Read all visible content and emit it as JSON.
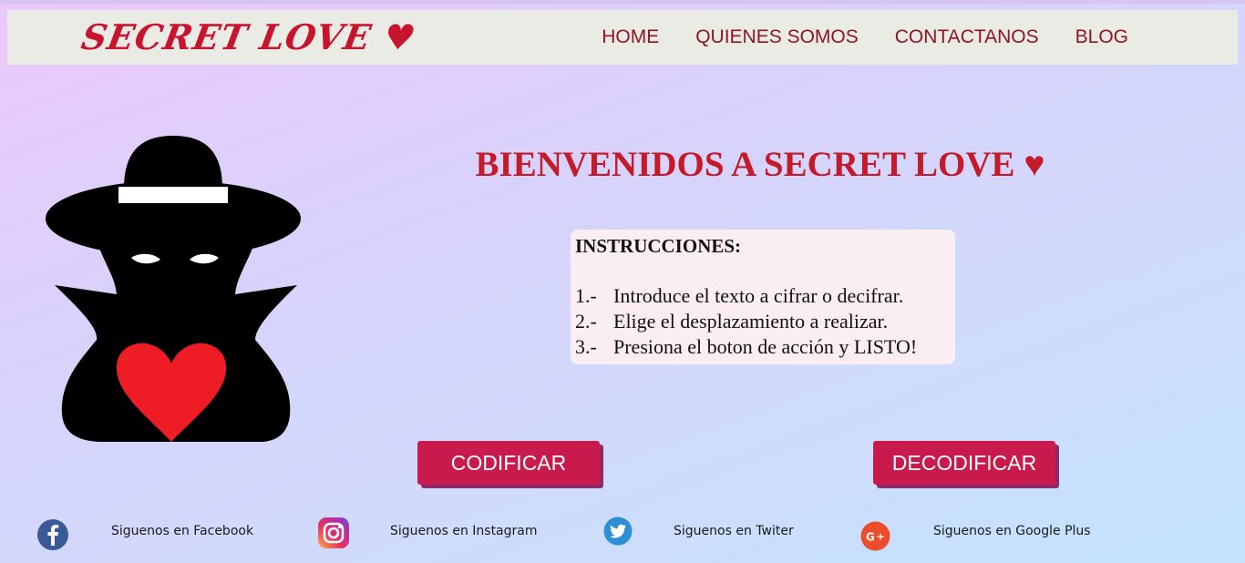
{
  "brand": {
    "title": "SECRET LOVE ♥"
  },
  "nav": {
    "items": [
      {
        "label": "HOME"
      },
      {
        "label": "QUIENES SOMOS"
      },
      {
        "label": "CONTACTANOS"
      },
      {
        "label": "BLOG"
      }
    ]
  },
  "main": {
    "heading": "BIENVENIDOS A SECRET LOVE ♥",
    "instructions": {
      "title": "INSTRUCCIONES:",
      "steps": [
        {
          "num": "1.-",
          "text": "Introduce el texto a cifrar o decifrar."
        },
        {
          "num": "2.-",
          "text": "Elige el desplazamiento a realizar."
        },
        {
          "num": "3.-",
          "text": "Presiona el boton de acción y LISTO!"
        }
      ]
    },
    "buttons": {
      "encode": "CODIFICAR",
      "decode": "DECODIFICAR"
    }
  },
  "footer": {
    "social": [
      {
        "icon": "facebook-icon",
        "label": "Siguenos en Facebook"
      },
      {
        "icon": "instagram-icon",
        "label": "Siguenos en Instagram"
      },
      {
        "icon": "twitter-icon",
        "label": "Siguenos en Twiter"
      },
      {
        "icon": "google-plus-icon",
        "label": "Siguenos en Google Plus"
      }
    ]
  },
  "colors": {
    "brand_red": "#c8142c",
    "nav_text": "#8e1624",
    "button": "#c91a4e",
    "button_shadow": "#8c2a6a",
    "navbar_bg": "#ebebe6",
    "instructions_bg": "#fbeef2"
  }
}
